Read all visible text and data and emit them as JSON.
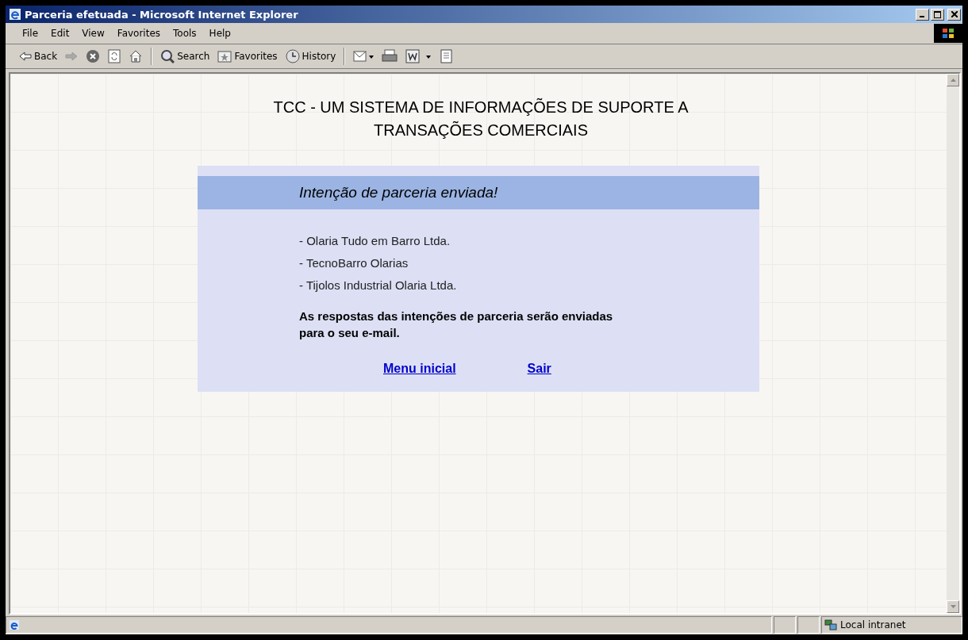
{
  "window": {
    "title": "Parceria efetuada - Microsoft Internet Explorer"
  },
  "menu": [
    "File",
    "Edit",
    "View",
    "Favorites",
    "Tools",
    "Help"
  ],
  "toolbar": [
    {
      "kind": "back",
      "label": "Back"
    },
    {
      "kind": "forward"
    },
    {
      "kind": "stop"
    },
    {
      "kind": "refresh"
    },
    {
      "kind": "home"
    },
    {
      "kind": "sep"
    },
    {
      "kind": "search",
      "label": "Search"
    },
    {
      "kind": "favorites",
      "label": "Favorites"
    },
    {
      "kind": "history",
      "label": "History"
    },
    {
      "kind": "sep"
    },
    {
      "kind": "mail"
    },
    {
      "kind": "print"
    },
    {
      "kind": "edit"
    },
    {
      "kind": "discuss"
    }
  ],
  "page": {
    "heading": [
      "TCC - UM SISTEMA DE INFORMAÇÕES DE SUPORTE A",
      "TRANSAÇÕES COMERCIAIS"
    ],
    "panel_title": "Intenção de parceria enviada!",
    "partners": [
      "- Olaria Tudo em Barro Ltda.",
      "- TecnoBarro Olarias",
      "- Tijolos Industrial Olaria Ltda."
    ],
    "notice": "As respostas das intenções de parceria serão enviadas para o seu e-mail.",
    "links": [
      "Menu inicial",
      "Sair"
    ]
  },
  "status_bar": {
    "zone": "Local intranet"
  }
}
